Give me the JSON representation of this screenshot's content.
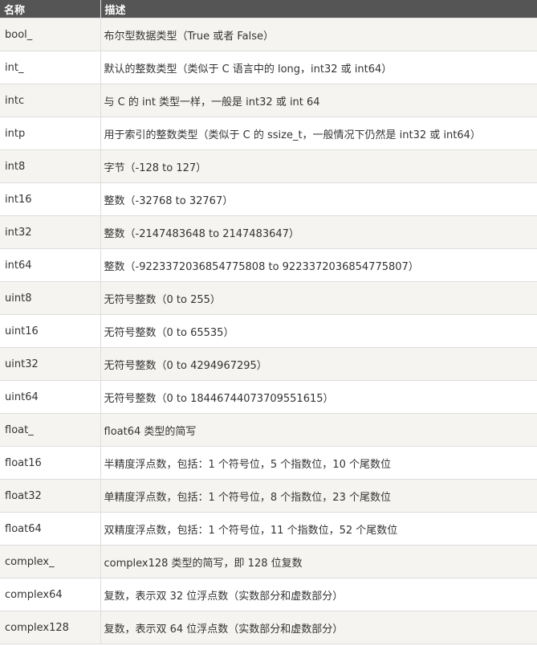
{
  "table": {
    "headers": {
      "name": "名称",
      "description": "描述"
    },
    "rows": [
      {
        "name": "bool_",
        "description": "布尔型数据类型（True 或者 False）"
      },
      {
        "name": "int_",
        "description": "默认的整数类型（类似于 C 语言中的 long，int32 或 int64）"
      },
      {
        "name": "intc",
        "description": "与 C 的 int 类型一样，一般是 int32 或 int 64"
      },
      {
        "name": "intp",
        "description": "用于索引的整数类型（类似于 C 的 ssize_t，一般情况下仍然是 int32 或 int64）"
      },
      {
        "name": "int8",
        "description": "字节（-128 to 127）"
      },
      {
        "name": "int16",
        "description": "整数（-32768 to 32767）"
      },
      {
        "name": "int32",
        "description": "整数（-2147483648 to 2147483647）"
      },
      {
        "name": "int64",
        "description": "整数（-9223372036854775808 to 9223372036854775807）"
      },
      {
        "name": "uint8",
        "description": "无符号整数（0 to 255）"
      },
      {
        "name": "uint16",
        "description": "无符号整数（0 to 65535）"
      },
      {
        "name": "uint32",
        "description": "无符号整数（0 to 4294967295）"
      },
      {
        "name": "uint64",
        "description": "无符号整数（0 to 18446744073709551615）"
      },
      {
        "name": "float_",
        "description": "float64 类型的简写"
      },
      {
        "name": "float16",
        "description": "半精度浮点数，包括：1 个符号位，5 个指数位，10 个尾数位"
      },
      {
        "name": "float32",
        "description": "单精度浮点数，包括：1 个符号位，8 个指数位，23 个尾数位"
      },
      {
        "name": "float64",
        "description": "双精度浮点数，包括：1 个符号位，11 个指数位，52 个尾数位"
      },
      {
        "name": "complex_",
        "description": "complex128 类型的简写，即 128 位复数"
      },
      {
        "name": "complex64",
        "description": "复数，表示双 32 位浮点数（实数部分和虚数部分）"
      },
      {
        "name": "complex128",
        "description": "复数，表示双 64 位浮点数（实数部分和虚数部分）"
      }
    ]
  }
}
